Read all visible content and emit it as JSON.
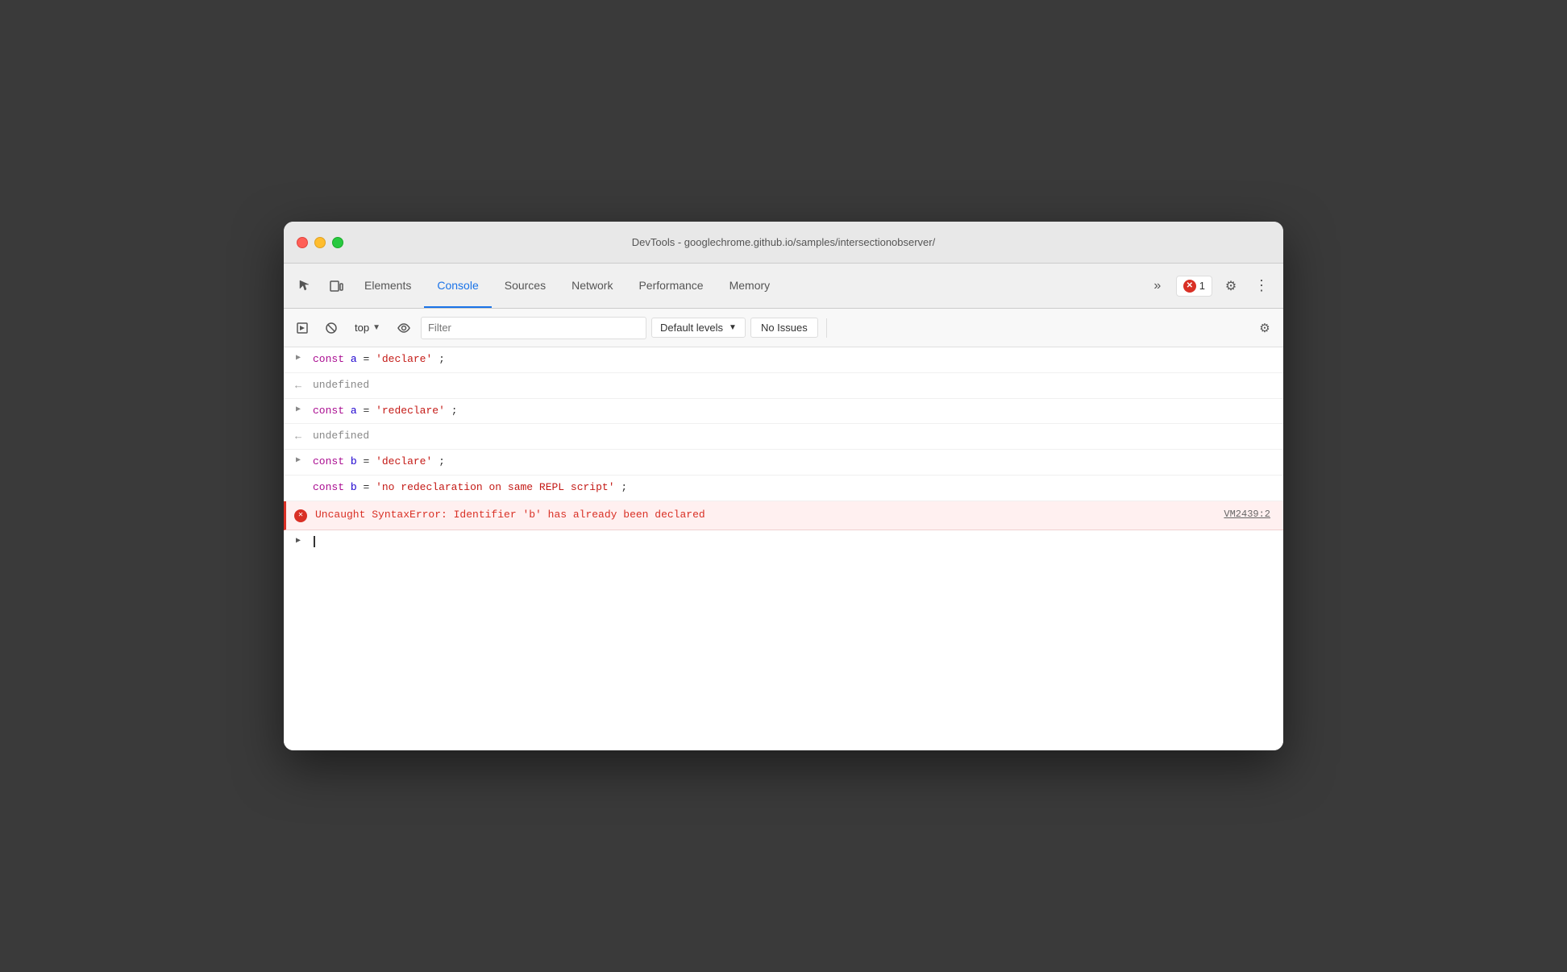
{
  "window": {
    "title": "DevTools - googlechrome.github.io/samples/intersectionobserver/"
  },
  "traffic_lights": {
    "close_label": "close",
    "minimize_label": "minimize",
    "maximize_label": "maximize"
  },
  "tabs": {
    "items": [
      {
        "id": "elements",
        "label": "Elements",
        "active": false
      },
      {
        "id": "console",
        "label": "Console",
        "active": true
      },
      {
        "id": "sources",
        "label": "Sources",
        "active": false
      },
      {
        "id": "network",
        "label": "Network",
        "active": false
      },
      {
        "id": "performance",
        "label": "Performance",
        "active": false
      },
      {
        "id": "memory",
        "label": "Memory",
        "active": false
      }
    ],
    "more_label": "»",
    "error_count": "1",
    "gear_label": "⚙",
    "menu_label": "⋮"
  },
  "console_toolbar": {
    "run_label": "▶",
    "clear_label": "🚫",
    "context": "top",
    "eye_label": "👁",
    "filter_placeholder": "Filter",
    "levels_label": "Default levels",
    "no_issues_label": "No Issues",
    "settings_label": "⚙"
  },
  "console_lines": [
    {
      "type": "input",
      "prefix": ">",
      "code": "const a = 'declare';"
    },
    {
      "type": "output",
      "prefix": "<",
      "text": "undefined"
    },
    {
      "type": "input",
      "prefix": ">",
      "code": "const a = 'redeclare';"
    },
    {
      "type": "output",
      "prefix": "<",
      "text": "undefined"
    },
    {
      "type": "input",
      "prefix": ">",
      "code": "const b = 'declare';"
    },
    {
      "type": "input-continuation",
      "prefix": "",
      "code": "const b = 'no redeclaration on same REPL script';"
    },
    {
      "type": "error",
      "text": "Uncaught SyntaxError: Identifier 'b' has already been declared",
      "link": "VM2439:2"
    }
  ],
  "colors": {
    "active_tab_underline": "#1a73e8",
    "active_tab_text": "#1a73e8",
    "error_red": "#d93025",
    "error_bg": "#fff0f0",
    "const_color": "#aa0d91",
    "varname_color": "#1c00cf",
    "string_color": "#c41a16"
  }
}
